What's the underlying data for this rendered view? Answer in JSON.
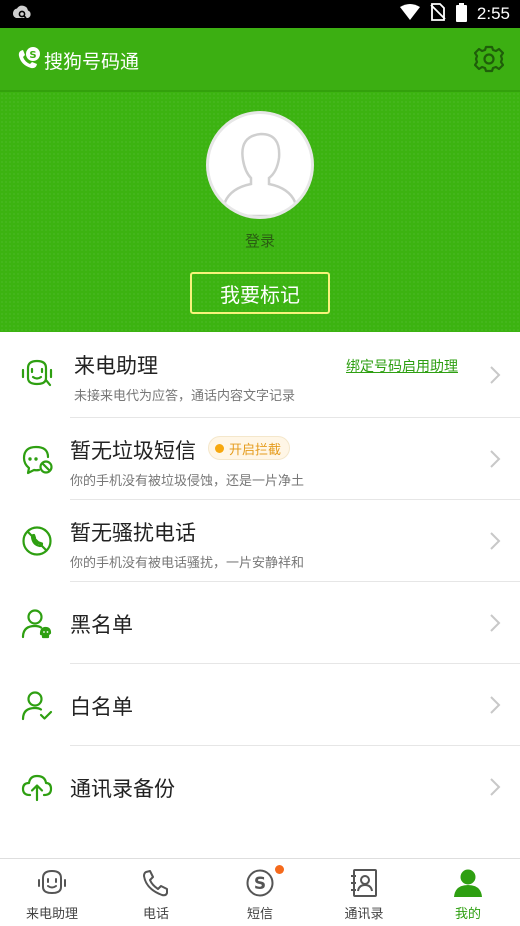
{
  "status_bar": {
    "time": "2:55"
  },
  "app_bar": {
    "title": "搜狗号码通"
  },
  "header": {
    "login_label": "登录",
    "mark_button": "我要标记"
  },
  "list": {
    "call_assistant": {
      "title": "来电助理",
      "subtitle": "未接来电代为应答，通话内容文字记录",
      "link": "绑定号码启用助理"
    },
    "spam_sms": {
      "title": "暂无垃圾短信",
      "badge": "开启拦截",
      "subtitle": "你的手机没有被垃圾侵蚀，还是一片净土"
    },
    "harass_call": {
      "title": "暂无骚扰电话",
      "subtitle": "你的手机没有被电话骚扰，一片安静祥和"
    },
    "blacklist": {
      "title": "黑名单"
    },
    "whitelist": {
      "title": "白名单"
    },
    "contacts_backup": {
      "title": "通讯录备份"
    }
  },
  "bottom_nav": {
    "items": [
      {
        "label": "来电助理",
        "icon": "robot-icon"
      },
      {
        "label": "电话",
        "icon": "phone-icon"
      },
      {
        "label": "短信",
        "icon": "sms-icon"
      },
      {
        "label": "通讯录",
        "icon": "contacts-icon"
      },
      {
        "label": "我的",
        "icon": "person-icon"
      }
    ],
    "active": "我的"
  },
  "colors": {
    "brand_green": "#3cb311",
    "link_green": "#2e9f11",
    "badge_orange": "#f7a80f",
    "notify_dot": "#f56a1c"
  }
}
